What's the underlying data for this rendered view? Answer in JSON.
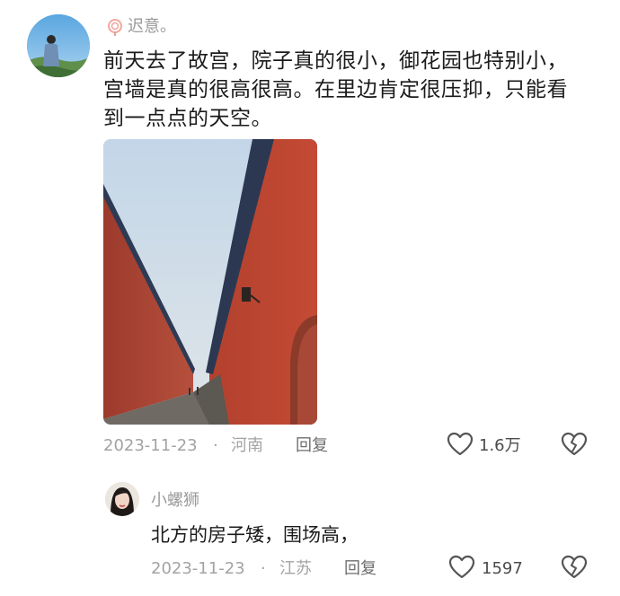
{
  "comment": {
    "username": "迟意。",
    "text": "前天去了故宫，院子真的很小，御花园也特别小，宫墙是真的很高很高。在里边肯定很压抑，只能看到一点点的天空。",
    "date": "2023-11-23",
    "separator": "·",
    "location": "河南",
    "reply_label": "回复",
    "like_count": "1.6万"
  },
  "reply": {
    "username": "小螺狮",
    "text": "北方的房子矮，围场高，",
    "date": "2023-11-23",
    "separator": "·",
    "location": "江苏",
    "reply_label": "回复",
    "like_count": "1597"
  },
  "colors": {
    "wall_red": "#b9412f",
    "roof_dark": "#2f3a52",
    "sky": "#c7d7e6",
    "meta_gray": "#a3a3a3"
  },
  "icons": {
    "like": "heart-outline-icon",
    "dislike": "broken-heart-icon",
    "badge": "lollipop-icon"
  }
}
